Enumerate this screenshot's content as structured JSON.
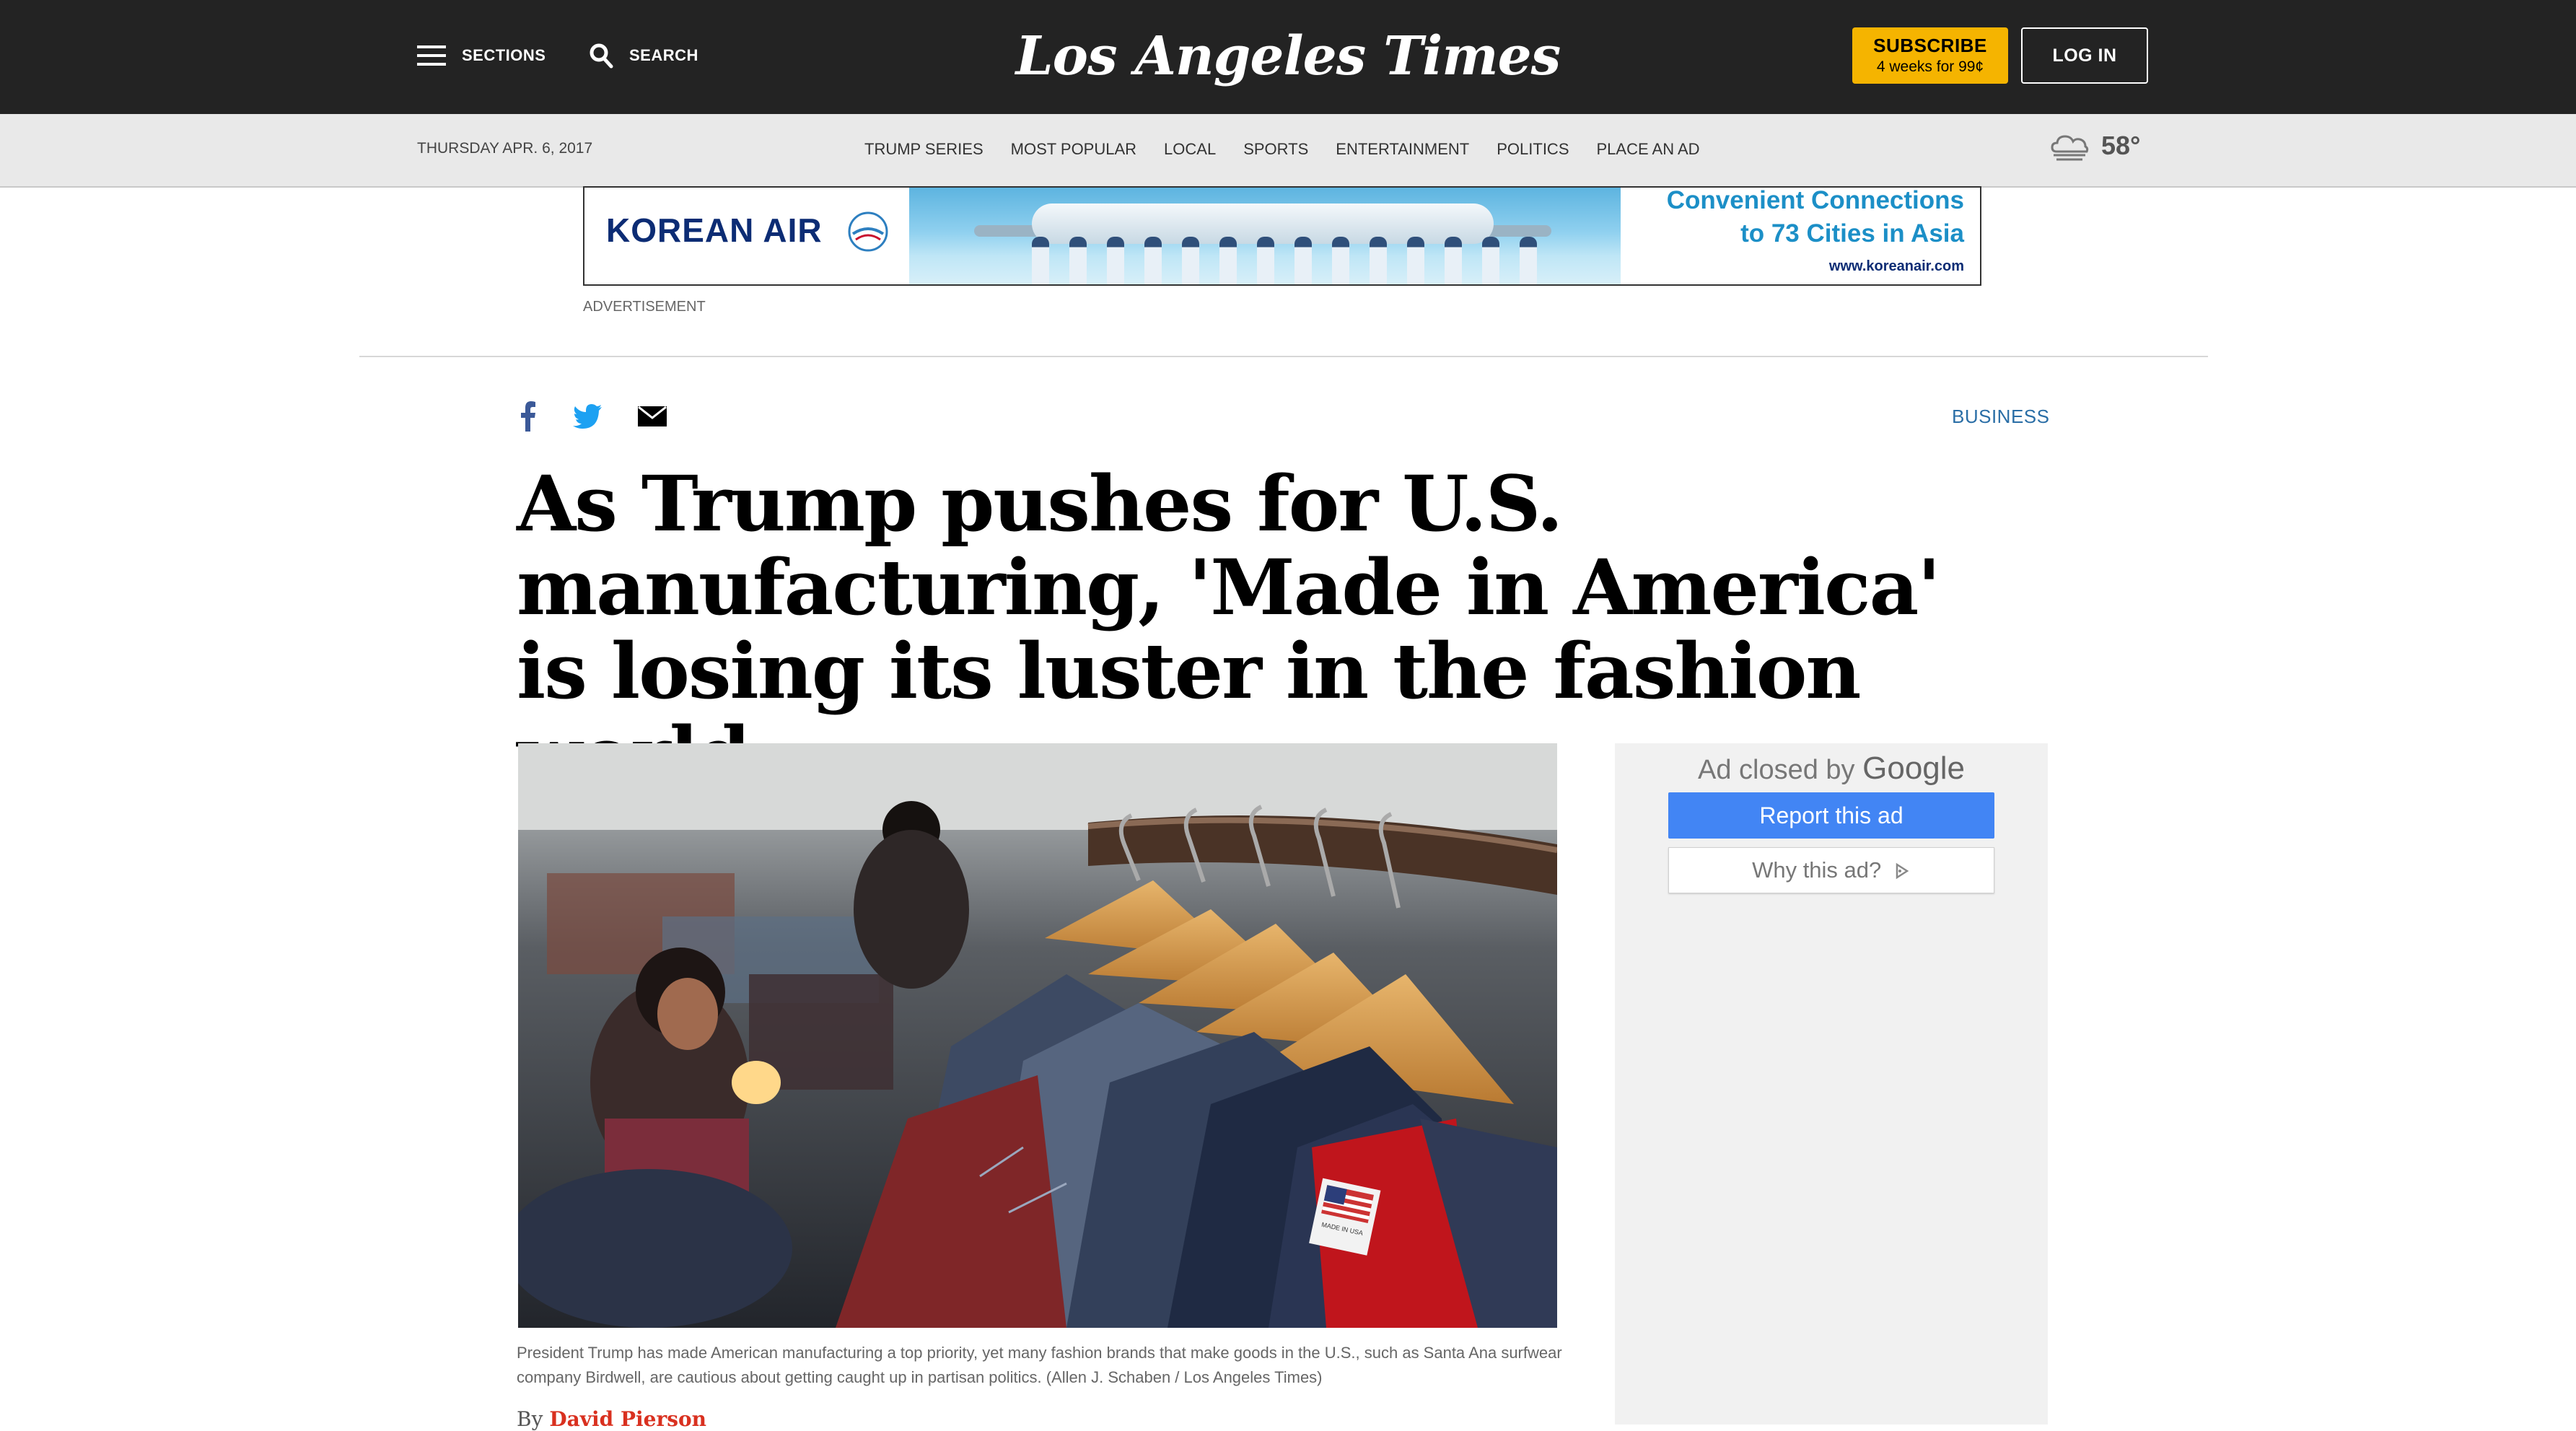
{
  "masthead": {
    "sections_label": "SECTIONS",
    "search_label": "SEARCH",
    "logo_text": "Los Angeles Times",
    "subscribe_label": "SUBSCRIBE",
    "subscribe_offer": "4 weeks for 99¢",
    "login_label": "LOG IN"
  },
  "subnav": {
    "date": "THURSDAY APR. 6, 2017",
    "links": [
      "TRUMP SERIES",
      "MOST POPULAR",
      "LOCAL",
      "SPORTS",
      "ENTERTAINMENT",
      "POLITICS",
      "PLACE AN AD"
    ],
    "temperature": "58°"
  },
  "ad_banner": {
    "brand": "KOREAN AIR",
    "line1": "Convenient Connections",
    "line2": "to 73 Cities in Asia",
    "url": "www.koreanair.com",
    "label": "ADVERTISEMENT"
  },
  "article": {
    "section": "BUSINESS",
    "headline": "As Trump pushes for U.S. manufacturing, 'Made in America' is losing its luster in the fashion world",
    "caption": "President Trump has made American manufacturing a top priority, yet many fashion brands that make goods in the U.S., such as Santa Ana surfwear company Birdwell, are cautious about getting caught up in partisan politics. (Allen J. Schaben / Los Angeles Times)",
    "byline_prefix": "By",
    "author": "David Pierson",
    "tag_text": "MADE IN USA"
  },
  "ad_closed": {
    "title_prefix": "Ad closed by",
    "title_brand": "Google",
    "report_label": "Report this ad",
    "why_label": "Why this ad?"
  },
  "colors": {
    "masthead_bg": "#232323",
    "subscribe_bg": "#f5b400",
    "link_blue": "#2a6ea6",
    "author_red": "#d9301f",
    "google_blue": "#4285f4"
  }
}
